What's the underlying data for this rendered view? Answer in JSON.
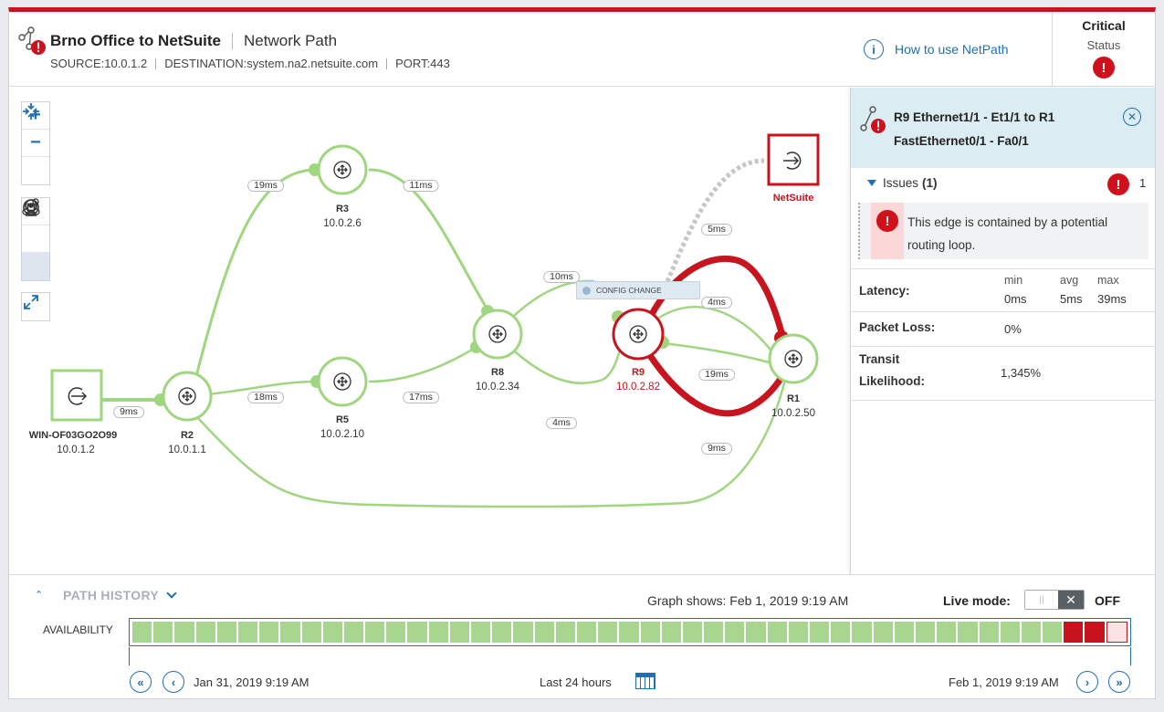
{
  "header": {
    "title": "Brno Office to NetSuite",
    "subtitle": "Network Path",
    "source": "SOURCE:10.0.1.2",
    "destination": "DESTINATION:system.na2.netsuite.com",
    "port": "PORT:443",
    "help_link": "How to use NetPath",
    "status_level": "Critical",
    "status_label": "Status"
  },
  "graph": {
    "zoom_in": "+",
    "zoom_out": "−",
    "nodes": {
      "source": {
        "name": "WIN-OF03GO2O99",
        "ip": "10.0.1.2"
      },
      "r2": {
        "name": "R2",
        "ip": "10.0.1.1"
      },
      "r3": {
        "name": "R3",
        "ip": "10.0.2.6"
      },
      "r5": {
        "name": "R5",
        "ip": "10.0.2.10"
      },
      "r8": {
        "name": "R8",
        "ip": "10.0.2.34"
      },
      "r9": {
        "name": "R9",
        "ip": "10.0.2.82"
      },
      "r1": {
        "name": "R1",
        "ip": "10.0.2.50"
      },
      "dest": {
        "name": "NetSuite"
      }
    },
    "latencies": {
      "src_r2": "9ms",
      "r2_r3": "19ms",
      "r3_r8": "11ms",
      "r2_r5": "18ms",
      "r5_r8": "17ms",
      "r8_r9": "10ms",
      "r9_r1_top": "5ms",
      "r9_r1_mid": "4ms",
      "r9_r1_low": "19ms",
      "r8_r1": "4ms",
      "r2_r1": "9ms"
    },
    "config_change": "CONFIG CHANGE"
  },
  "panel": {
    "title": "R9 Ethernet1/1 - Et1/1 to R1 FastEthernet0/1 - Fa0/1",
    "issues_label": "Issues",
    "issues_count_paren": "(1)",
    "issues_count": "1",
    "issue_text": "This edge is contained by a potential routing loop.",
    "latency_label": "Latency:",
    "latency_min_head": "min",
    "latency_avg_head": "avg",
    "latency_max_head": "max",
    "latency_min": "0ms",
    "latency_avg": "5ms",
    "latency_max": "39ms",
    "packet_loss_label": "Packet Loss:",
    "packet_loss": "0%",
    "transit_label": "Transit Likelihood:",
    "transit": "1,345%"
  },
  "history": {
    "title": "PATH HISTORY",
    "graph_shows": "Graph shows: Feb 1, 2019 9:19 AM",
    "live_label": "Live mode:",
    "live_state": "OFF",
    "availability_label": "AVAILABILITY",
    "availability_cells": 47,
    "availability_red_cells": 2,
    "availability_pink_cells": 1,
    "start_time": "Jan 31, 2019 9:19 AM",
    "range": "Last 24 hours",
    "end_time": "Feb 1, 2019 9:19 AM"
  },
  "colors": {
    "accent": "#1f6fb2",
    "critical": "#c8141e",
    "healthy_link": "#9fd67f",
    "panel_header": "#dbecf2"
  }
}
